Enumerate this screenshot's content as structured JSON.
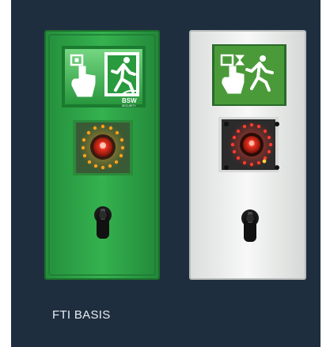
{
  "colors": {
    "background": "#1f2e3f",
    "device_green": "#2fa84a",
    "device_white": "#f3f4f3",
    "sign_green": "#1f8f3a",
    "led_amber": "#ff9a1a",
    "led_red": "#ff3b2f"
  },
  "icons": {
    "left_sign": "emergency-exit-push-button-icon",
    "right_sign": "emergency-exit-push-button-icon"
  },
  "devices": {
    "left": {
      "logo_text": "BSW",
      "logo_sub": "SECURITY"
    }
  },
  "caption": "FTI BASIS"
}
